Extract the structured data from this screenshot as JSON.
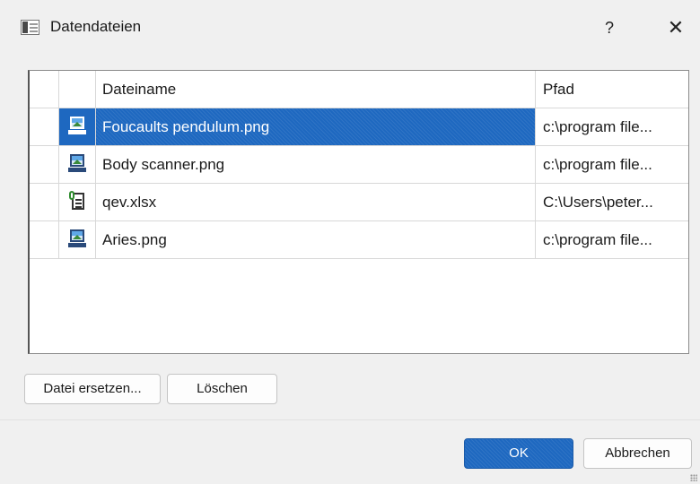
{
  "dialog": {
    "title": "Datendateien",
    "help": "?",
    "close": "✕"
  },
  "table": {
    "headers": {
      "name": "Dateiname",
      "path": "Pfad"
    },
    "rows": [
      {
        "icon": "image-file-icon",
        "name": "Foucaults pendulum.png",
        "path": "c:\\program file...",
        "selected": true
      },
      {
        "icon": "image-file-icon",
        "name": "Body scanner.png",
        "path": "c:\\program file...",
        "selected": false
      },
      {
        "icon": "spreadsheet-file-icon",
        "name": "qev.xlsx",
        "path": "C:\\Users\\peter...",
        "selected": false
      },
      {
        "icon": "image-file-icon",
        "name": "Aries.png",
        "path": "c:\\program file...",
        "selected": false
      }
    ]
  },
  "actions": {
    "replace": "Datei ersetzen...",
    "delete": "Löschen"
  },
  "footer": {
    "ok": "OK",
    "cancel": "Abbrechen"
  },
  "colors": {
    "accent": "#1e68c0",
    "background": "#f0f0f0"
  }
}
